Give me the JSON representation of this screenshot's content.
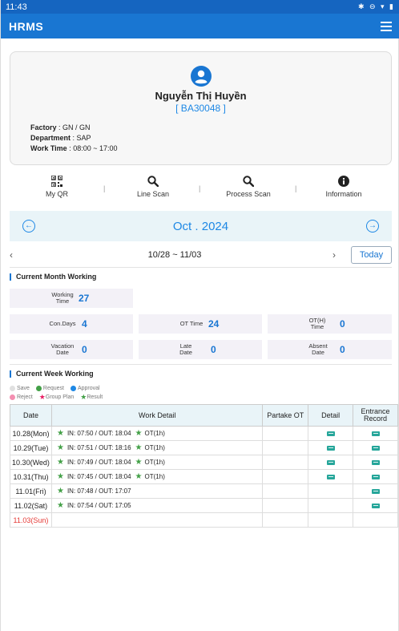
{
  "status_bar": {
    "time": "11:43",
    "icons": "✱ ⊖ ▾ ▮"
  },
  "app": {
    "title": "HRMS"
  },
  "profile": {
    "name": "Nguyễn Thị Huyền",
    "code": "[ BA30048 ]",
    "factory_label": "Factory",
    "factory_value": " : GN / GN",
    "department_label": "Department",
    "department_value": " : SAP",
    "worktime_label": "Work Time",
    "worktime_value": " : 08:00 ~ 17:00"
  },
  "quick_actions": [
    {
      "label": "My QR",
      "icon": "qr-code-icon"
    },
    {
      "label": "Line Scan",
      "icon": "search-icon"
    },
    {
      "label": "Process Scan",
      "icon": "search-icon"
    },
    {
      "label": "Information",
      "icon": "info-icon"
    }
  ],
  "separator": "|",
  "month": {
    "label": "Oct . 2024",
    "prev_icon": "←",
    "next_icon": "→"
  },
  "week": {
    "range": "10/28 ~ 11/03",
    "prev_icon": "‹",
    "next_icon": "›",
    "today_label": "Today"
  },
  "current_month": {
    "title": "Current Month Working",
    "working_time_label": "Working Time",
    "working_time_value": "27",
    "con_days_label": "Con.Days",
    "con_days_value": "4",
    "ot_time_label": "OT Time",
    "ot_time_value": "24",
    "ot_h_label": "OT(H) Time",
    "ot_h_value": "0",
    "vacation_label": "Vacation Date",
    "vacation_value": "0",
    "late_label": "Late Date",
    "late_value": "0",
    "absent_label": "Absent Date",
    "absent_value": "0"
  },
  "current_week": {
    "title": "Current Week Working",
    "legend": [
      {
        "label": "Save",
        "color": "#e0e0e0",
        "shape": "dot"
      },
      {
        "label": "Request",
        "color": "#43a047",
        "shape": "dot"
      },
      {
        "label": "Approval",
        "color": "#1e88e5",
        "shape": "dot"
      },
      {
        "label": "Reject",
        "color": "#f48fb1",
        "shape": "dot"
      },
      {
        "label": "Group Plan",
        "color": "#e91e63",
        "shape": "star"
      },
      {
        "label": "Result",
        "color": "#43a047",
        "shape": "star"
      }
    ],
    "columns": [
      "Date",
      "Work Detail",
      "Partake OT",
      "Detail",
      "Entrance Record"
    ],
    "rows": [
      {
        "date": "10.28(Mon)",
        "in_out": "IN: 07:50 / OUT: 18:04",
        "ot": "OT(1h)",
        "detail": true,
        "entrance": true,
        "sunday": false
      },
      {
        "date": "10.29(Tue)",
        "in_out": "IN: 07:51 / OUT: 18:16",
        "ot": "OT(1h)",
        "detail": true,
        "entrance": true,
        "sunday": false
      },
      {
        "date": "10.30(Wed)",
        "in_out": "IN: 07:49 / OUT: 18:04",
        "ot": "OT(1h)",
        "detail": true,
        "entrance": true,
        "sunday": false
      },
      {
        "date": "10.31(Thu)",
        "in_out": "IN: 07:45 / OUT: 18:04",
        "ot": "OT(1h)",
        "detail": true,
        "entrance": true,
        "sunday": false
      },
      {
        "date": "11.01(Fri)",
        "in_out": "IN: 07:48 / OUT: 17:07",
        "ot": "",
        "detail": false,
        "entrance": true,
        "sunday": false
      },
      {
        "date": "11.02(Sat)",
        "in_out": "IN: 07:54 / OUT: 17:05",
        "ot": "",
        "detail": false,
        "entrance": true,
        "sunday": false
      },
      {
        "date": "11.03(Sun)",
        "in_out": "",
        "ot": "",
        "detail": false,
        "entrance": false,
        "sunday": true
      }
    ]
  }
}
